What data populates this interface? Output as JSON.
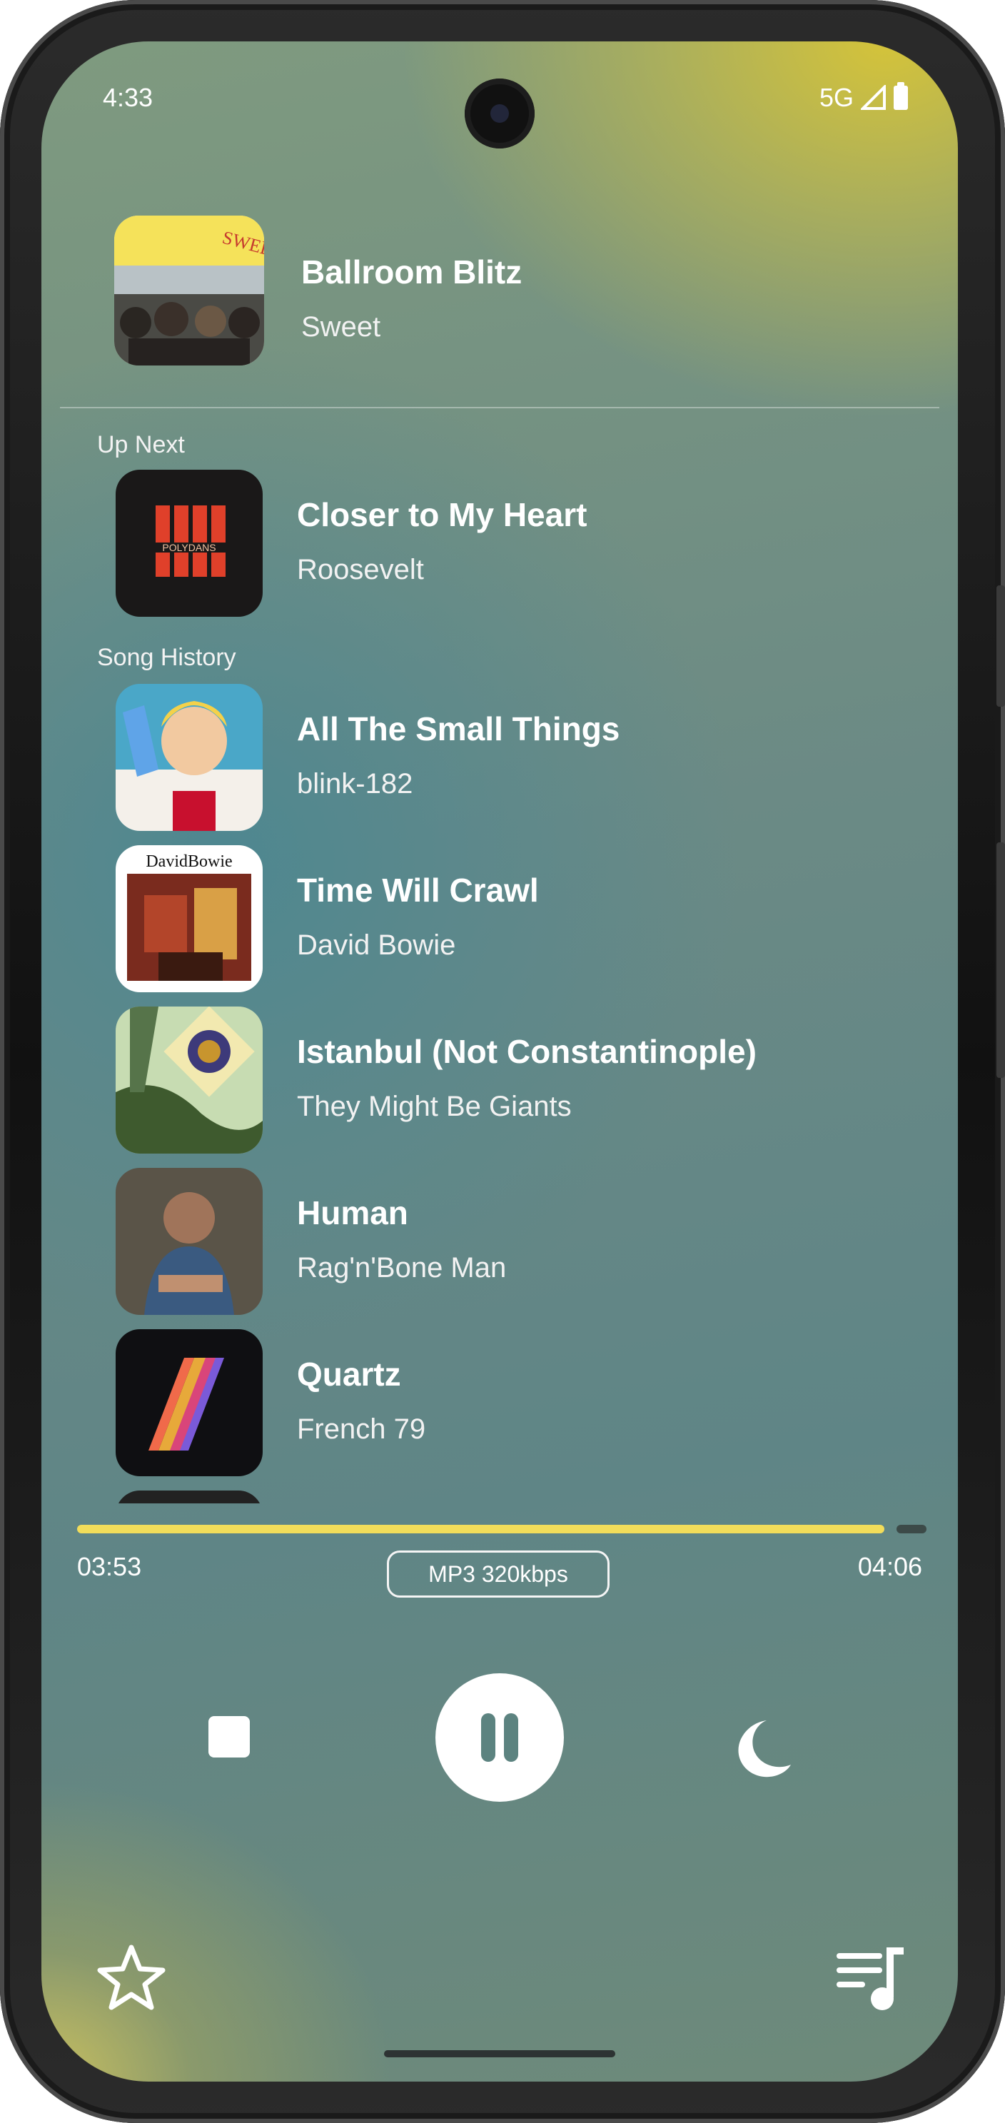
{
  "status_bar": {
    "time": "4:33",
    "network": "5G"
  },
  "now_playing": {
    "title": "Ballroom Blitz",
    "artist": "Sweet"
  },
  "up_next": {
    "label": "Up Next",
    "items": [
      {
        "title": "Closer to My Heart",
        "artist": "Roosevelt"
      }
    ]
  },
  "history": {
    "label": "Song History",
    "items": [
      {
        "title": "All The Small Things",
        "artist": "blink-182"
      },
      {
        "title": "Time Will Crawl",
        "artist": "David Bowie"
      },
      {
        "title": "Istanbul (Not Constantinople)",
        "artist": "They Might Be Giants"
      },
      {
        "title": "Human",
        "artist": "Rag'n'Bone Man"
      },
      {
        "title": "Quartz",
        "artist": "French 79"
      }
    ]
  },
  "progress": {
    "elapsed": "03:53",
    "total": "04:06",
    "fraction": 0.95,
    "format": "MP3 320kbps"
  },
  "controls": {
    "stop": "stop-icon",
    "play_pause": "pause-icon",
    "sleep": "moon-icon",
    "favorite": "star-icon",
    "queue": "queue-music-icon"
  },
  "colors": {
    "accent": "#f2dd5a",
    "play_bg": "#ffffff",
    "icon_on_play": "#5c8380"
  }
}
